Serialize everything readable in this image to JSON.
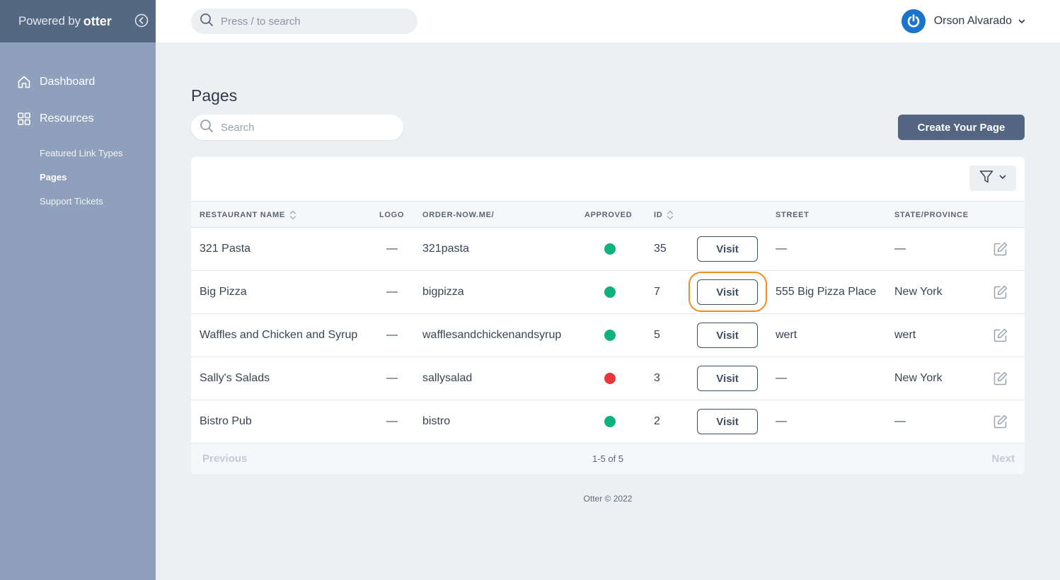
{
  "brand": {
    "prefix": "Powered by",
    "name": "otter"
  },
  "sidebar": {
    "nav": [
      {
        "label": "Dashboard",
        "icon": "home-icon"
      },
      {
        "label": "Resources",
        "icon": "grid-icon"
      }
    ],
    "sub_items": [
      {
        "label": "Featured Link Types",
        "active": false
      },
      {
        "label": "Pages",
        "active": true
      },
      {
        "label": "Support Tickets",
        "active": false
      }
    ]
  },
  "topbar": {
    "search_placeholder": "Press / to search",
    "user_name": "Orson Alvarado"
  },
  "main": {
    "title": "Pages",
    "search_placeholder": "Search",
    "create_label": "Create Your Page"
  },
  "table": {
    "headers": {
      "name": "RESTAURANT NAME",
      "logo": "LOGO",
      "slug": "ORDER-NOW.ME/",
      "approved": "APPROVED",
      "id": "ID",
      "street": "STREET",
      "state": "STATE/PROVINCE"
    },
    "visit_label": "Visit",
    "rows": [
      {
        "name": "321 Pasta",
        "logo": "—",
        "slug": "321pasta",
        "approved": true,
        "id": "35",
        "street": "—",
        "state": "—"
      },
      {
        "name": "Big Pizza",
        "logo": "—",
        "slug": "bigpizza",
        "approved": true,
        "id": "7",
        "street": "555 Big Pizza Place",
        "state": "New York"
      },
      {
        "name": "Waffles and Chicken and Syrup",
        "logo": "—",
        "slug": "wafflesandchickenandsyrup",
        "approved": true,
        "id": "5",
        "street": "wert",
        "state": "wert"
      },
      {
        "name": "Sally's Salads",
        "logo": "—",
        "slug": "sallysalad",
        "approved": false,
        "id": "3",
        "street": "—",
        "state": "New York"
      },
      {
        "name": "Bistro Pub",
        "logo": "—",
        "slug": "bistro",
        "approved": true,
        "id": "2",
        "street": "—",
        "state": "—"
      }
    ],
    "pagination": {
      "previous": "Previous",
      "count": "1-5 of 5",
      "next": "Next"
    }
  },
  "footer": "Otter © 2022",
  "colors": {
    "approved": "#0fb37a",
    "not_approved": "#e8363d",
    "accent": "#536580",
    "highlight": "#f08a24"
  }
}
